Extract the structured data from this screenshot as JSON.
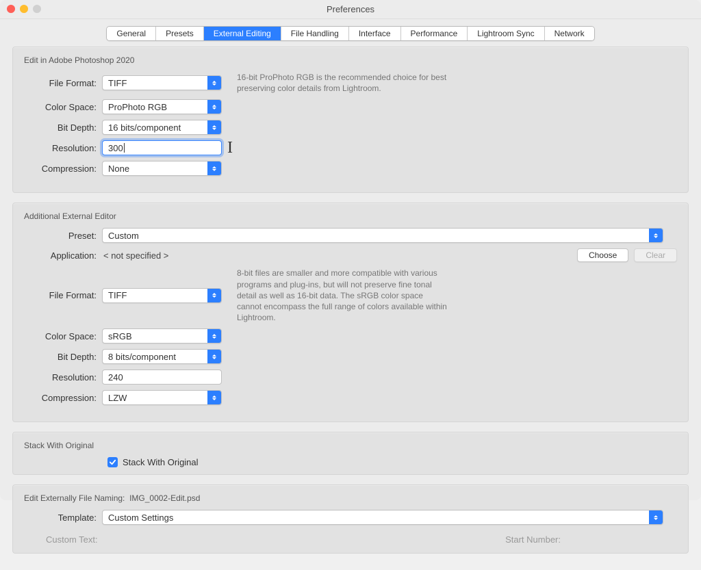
{
  "window": {
    "title": "Preferences"
  },
  "tabs": {
    "items": [
      {
        "label": "General"
      },
      {
        "label": "Presets"
      },
      {
        "label": "External Editing"
      },
      {
        "label": "File Handling"
      },
      {
        "label": "Interface"
      },
      {
        "label": "Performance"
      },
      {
        "label": "Lightroom Sync"
      },
      {
        "label": "Network"
      }
    ],
    "active_index": 2
  },
  "photoshop": {
    "title": "Edit in Adobe Photoshop 2020",
    "labels": {
      "file_format": "File Format:",
      "color_space": "Color Space:",
      "bit_depth": "Bit Depth:",
      "resolution": "Resolution:",
      "compression": "Compression:"
    },
    "file_format": "TIFF",
    "color_space": "ProPhoto RGB",
    "bit_depth": "16 bits/component",
    "resolution": "300",
    "compression": "None",
    "hint": "16-bit ProPhoto RGB is the recommended choice for best preserving color details from Lightroom."
  },
  "external": {
    "title": "Additional External Editor",
    "labels": {
      "preset": "Preset:",
      "application": "Application:",
      "file_format": "File Format:",
      "color_space": "Color Space:",
      "bit_depth": "Bit Depth:",
      "resolution": "Resolution:",
      "compression": "Compression:"
    },
    "preset": "Custom",
    "application": "< not specified >",
    "choose_label": "Choose",
    "clear_label": "Clear",
    "file_format": "TIFF",
    "color_space": "sRGB",
    "bit_depth": "8 bits/component",
    "resolution": "240",
    "compression": "LZW",
    "hint": "8-bit files are smaller and more compatible with various programs and plug-ins, but will not preserve fine tonal detail as well as 16-bit data. The sRGB color space cannot encompass the full range of colors available within Lightroom."
  },
  "stack": {
    "title": "Stack With Original",
    "checkbox_label": "Stack With Original",
    "checked": true
  },
  "naming": {
    "title_prefix": "Edit Externally File Naming:",
    "title_file": "IMG_0002-Edit.psd",
    "template_label": "Template:",
    "template": "Custom Settings",
    "custom_text_label": "Custom Text:",
    "start_number_label": "Start Number:"
  }
}
